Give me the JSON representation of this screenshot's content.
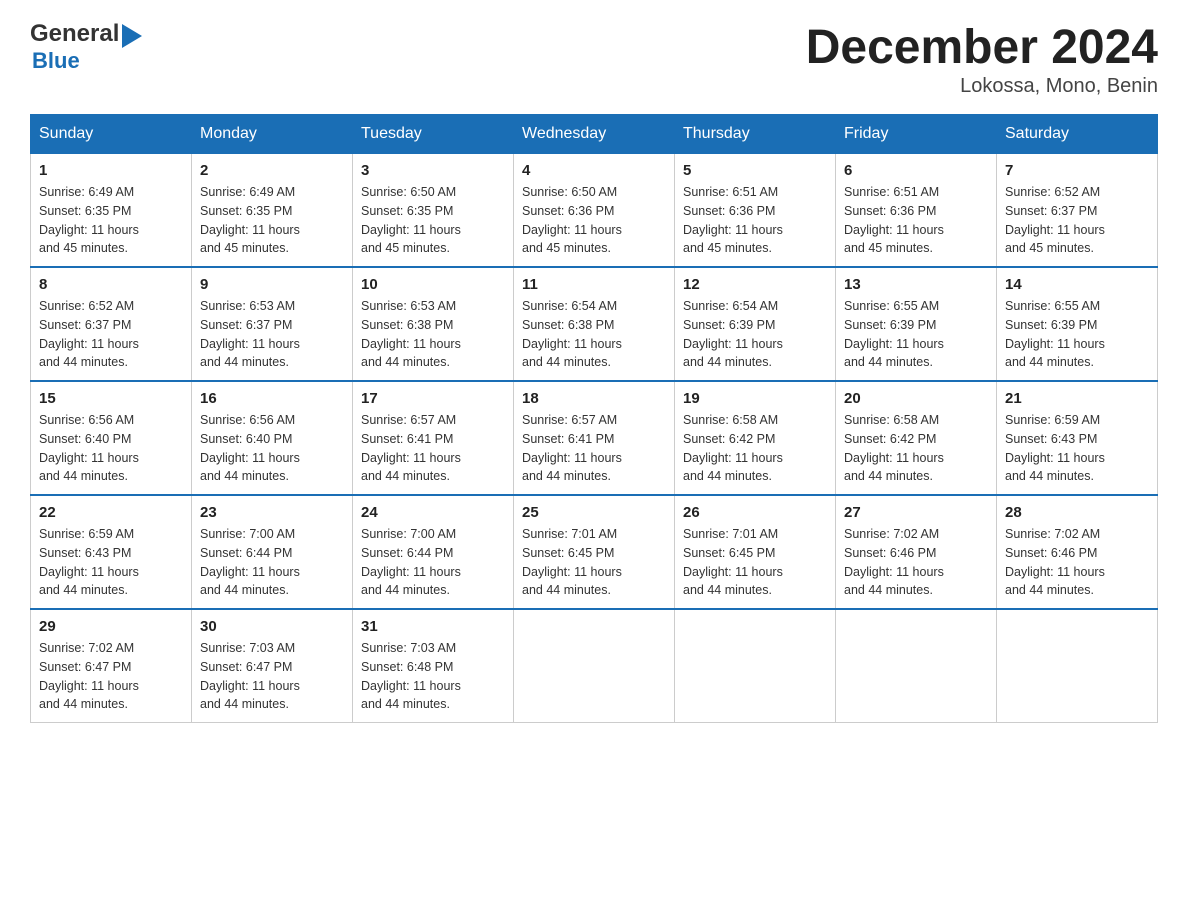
{
  "logo": {
    "line1": "General",
    "arrow": "▶",
    "line2": "Blue"
  },
  "title": "December 2024",
  "subtitle": "Lokossa, Mono, Benin",
  "days_header": [
    "Sunday",
    "Monday",
    "Tuesday",
    "Wednesday",
    "Thursday",
    "Friday",
    "Saturday"
  ],
  "weeks": [
    [
      {
        "day": "1",
        "sunrise": "6:49 AM",
        "sunset": "6:35 PM",
        "daylight": "11 hours and 45 minutes."
      },
      {
        "day": "2",
        "sunrise": "6:49 AM",
        "sunset": "6:35 PM",
        "daylight": "11 hours and 45 minutes."
      },
      {
        "day": "3",
        "sunrise": "6:50 AM",
        "sunset": "6:35 PM",
        "daylight": "11 hours and 45 minutes."
      },
      {
        "day": "4",
        "sunrise": "6:50 AM",
        "sunset": "6:36 PM",
        "daylight": "11 hours and 45 minutes."
      },
      {
        "day": "5",
        "sunrise": "6:51 AM",
        "sunset": "6:36 PM",
        "daylight": "11 hours and 45 minutes."
      },
      {
        "day": "6",
        "sunrise": "6:51 AM",
        "sunset": "6:36 PM",
        "daylight": "11 hours and 45 minutes."
      },
      {
        "day": "7",
        "sunrise": "6:52 AM",
        "sunset": "6:37 PM",
        "daylight": "11 hours and 45 minutes."
      }
    ],
    [
      {
        "day": "8",
        "sunrise": "6:52 AM",
        "sunset": "6:37 PM",
        "daylight": "11 hours and 44 minutes."
      },
      {
        "day": "9",
        "sunrise": "6:53 AM",
        "sunset": "6:37 PM",
        "daylight": "11 hours and 44 minutes."
      },
      {
        "day": "10",
        "sunrise": "6:53 AM",
        "sunset": "6:38 PM",
        "daylight": "11 hours and 44 minutes."
      },
      {
        "day": "11",
        "sunrise": "6:54 AM",
        "sunset": "6:38 PM",
        "daylight": "11 hours and 44 minutes."
      },
      {
        "day": "12",
        "sunrise": "6:54 AM",
        "sunset": "6:39 PM",
        "daylight": "11 hours and 44 minutes."
      },
      {
        "day": "13",
        "sunrise": "6:55 AM",
        "sunset": "6:39 PM",
        "daylight": "11 hours and 44 minutes."
      },
      {
        "day": "14",
        "sunrise": "6:55 AM",
        "sunset": "6:39 PM",
        "daylight": "11 hours and 44 minutes."
      }
    ],
    [
      {
        "day": "15",
        "sunrise": "6:56 AM",
        "sunset": "6:40 PM",
        "daylight": "11 hours and 44 minutes."
      },
      {
        "day": "16",
        "sunrise": "6:56 AM",
        "sunset": "6:40 PM",
        "daylight": "11 hours and 44 minutes."
      },
      {
        "day": "17",
        "sunrise": "6:57 AM",
        "sunset": "6:41 PM",
        "daylight": "11 hours and 44 minutes."
      },
      {
        "day": "18",
        "sunrise": "6:57 AM",
        "sunset": "6:41 PM",
        "daylight": "11 hours and 44 minutes."
      },
      {
        "day": "19",
        "sunrise": "6:58 AM",
        "sunset": "6:42 PM",
        "daylight": "11 hours and 44 minutes."
      },
      {
        "day": "20",
        "sunrise": "6:58 AM",
        "sunset": "6:42 PM",
        "daylight": "11 hours and 44 minutes."
      },
      {
        "day": "21",
        "sunrise": "6:59 AM",
        "sunset": "6:43 PM",
        "daylight": "11 hours and 44 minutes."
      }
    ],
    [
      {
        "day": "22",
        "sunrise": "6:59 AM",
        "sunset": "6:43 PM",
        "daylight": "11 hours and 44 minutes."
      },
      {
        "day": "23",
        "sunrise": "7:00 AM",
        "sunset": "6:44 PM",
        "daylight": "11 hours and 44 minutes."
      },
      {
        "day": "24",
        "sunrise": "7:00 AM",
        "sunset": "6:44 PM",
        "daylight": "11 hours and 44 minutes."
      },
      {
        "day": "25",
        "sunrise": "7:01 AM",
        "sunset": "6:45 PM",
        "daylight": "11 hours and 44 minutes."
      },
      {
        "day": "26",
        "sunrise": "7:01 AM",
        "sunset": "6:45 PM",
        "daylight": "11 hours and 44 minutes."
      },
      {
        "day": "27",
        "sunrise": "7:02 AM",
        "sunset": "6:46 PM",
        "daylight": "11 hours and 44 minutes."
      },
      {
        "day": "28",
        "sunrise": "7:02 AM",
        "sunset": "6:46 PM",
        "daylight": "11 hours and 44 minutes."
      }
    ],
    [
      {
        "day": "29",
        "sunrise": "7:02 AM",
        "sunset": "6:47 PM",
        "daylight": "11 hours and 44 minutes."
      },
      {
        "day": "30",
        "sunrise": "7:03 AM",
        "sunset": "6:47 PM",
        "daylight": "11 hours and 44 minutes."
      },
      {
        "day": "31",
        "sunrise": "7:03 AM",
        "sunset": "6:48 PM",
        "daylight": "11 hours and 44 minutes."
      },
      null,
      null,
      null,
      null
    ]
  ]
}
